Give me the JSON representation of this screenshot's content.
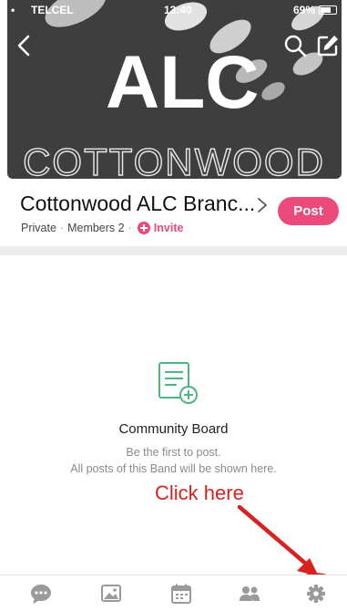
{
  "status_bar": {
    "dots": "•",
    "carrier": "TELCEL",
    "time": "13:40",
    "battery": "69%",
    "battery_level": 0.69
  },
  "cover": {
    "logo_text": "ALC",
    "subtitle": "COTTONWOOD"
  },
  "header": {
    "back_icon": "chevron-left-icon",
    "search_icon": "search-icon",
    "edit_icon": "compose-icon"
  },
  "band": {
    "title": "Cottonwood ALC Branc...",
    "privacy": "Private",
    "members": "Members 2",
    "separator": "·",
    "invite_label": "Invite",
    "post_label": "Post",
    "accent_color": "#ec4a7a"
  },
  "board": {
    "title": "Community Board",
    "line1": "Be the first to post.",
    "line2": "All posts of this Band will be shown here.",
    "icon_color": "#4cb782"
  },
  "annotation": {
    "text": "Click here",
    "color": "#d8221f"
  },
  "bottom_nav": {
    "items": [
      {
        "icon": "chat-icon"
      },
      {
        "icon": "photos-icon"
      },
      {
        "icon": "calendar-icon"
      },
      {
        "icon": "members-icon"
      },
      {
        "icon": "settings-gear-icon"
      }
    ]
  }
}
